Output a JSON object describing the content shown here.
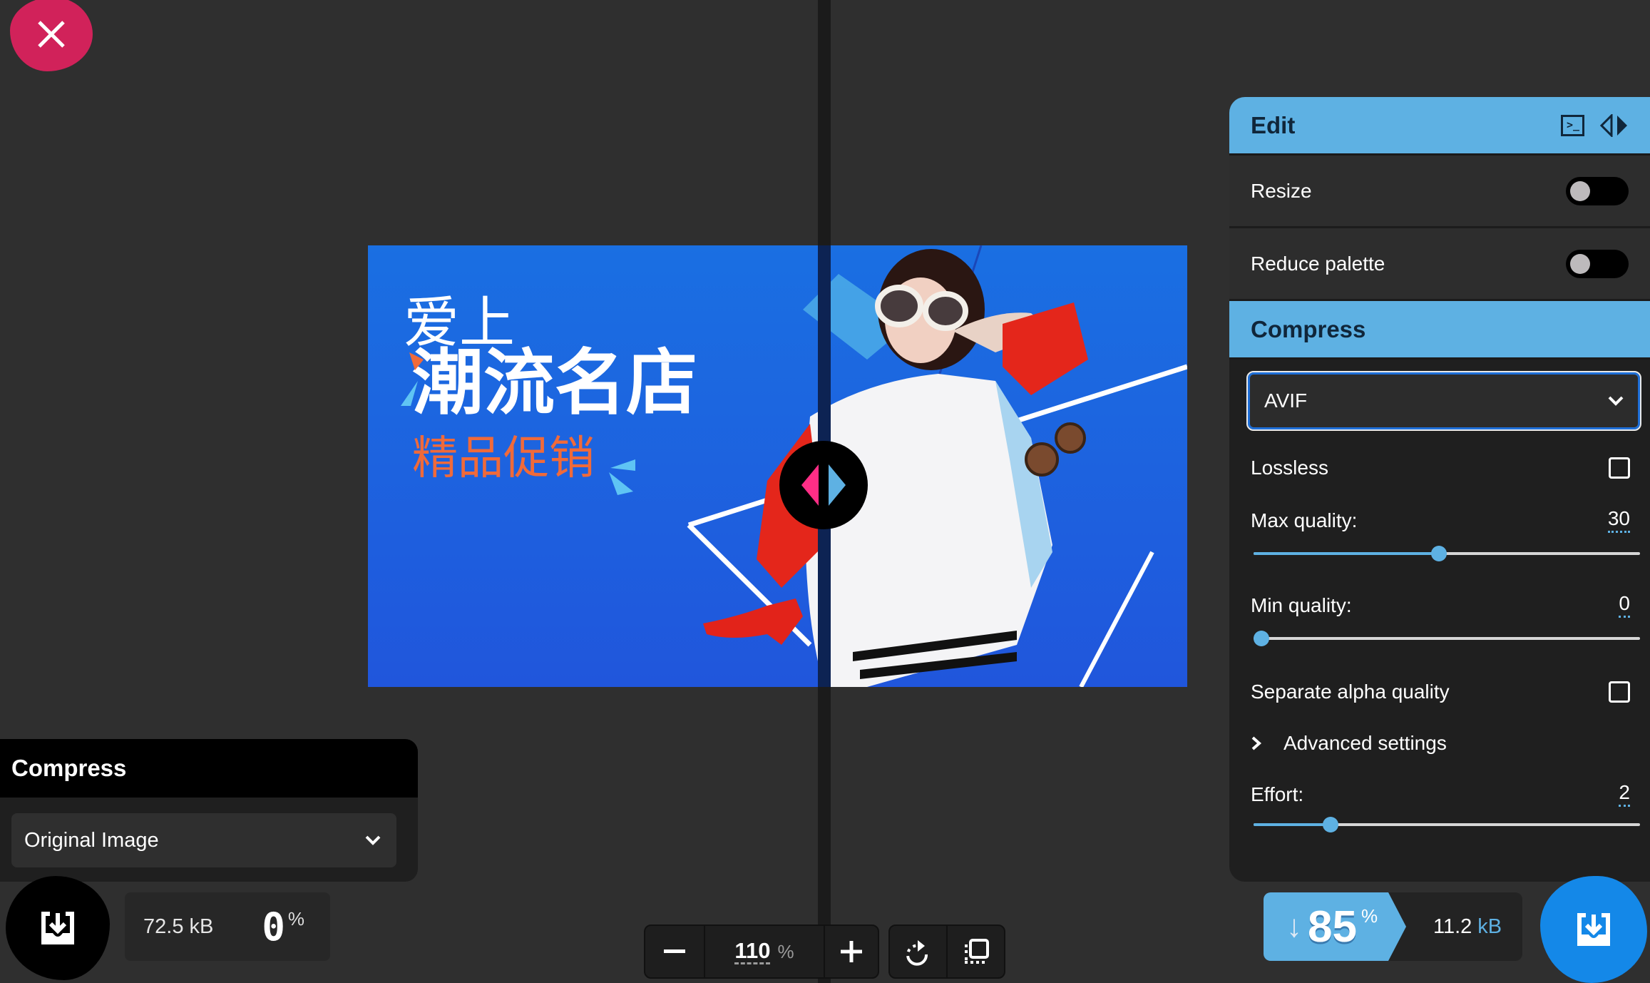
{
  "close": {
    "icon": "close-icon"
  },
  "image": {
    "headline_small": "爱上",
    "headline_large": "潮流名店",
    "subline": "精品促销",
    "colors": {
      "background": "#1f66e0",
      "accent_orange": "#f06a3a",
      "accent_cyan": "#5fc4f4",
      "shirt_red": "#e0261c"
    }
  },
  "compare_handle": {
    "left_color": "#ff2e86",
    "right_color": "#5eb1e3"
  },
  "right_panel": {
    "edit_title": "Edit",
    "edit_icons": [
      "terminal-icon",
      "compare-toggle-icon"
    ],
    "resize_label": "Resize",
    "resize_on": false,
    "reduce_palette_label": "Reduce palette",
    "reduce_palette_on": false,
    "compress_title": "Compress",
    "format_selected": "AVIF",
    "lossless_label": "Lossless",
    "lossless_checked": false,
    "max_quality_label": "Max quality:",
    "max_quality_value": "30",
    "max_quality_fraction": 0.48,
    "min_quality_label": "Min quality:",
    "min_quality_value": "0",
    "min_quality_fraction": 0.0,
    "separate_alpha_label": "Separate alpha quality",
    "separate_alpha_checked": false,
    "advanced_label": "Advanced settings",
    "effort_label": "Effort:",
    "effort_value": "2",
    "effort_fraction": 0.2
  },
  "left_panel": {
    "title": "Compress",
    "format_selected": "Original Image"
  },
  "original_stats": {
    "size": "72.5 kB",
    "percent": "0",
    "percent_sign": "%"
  },
  "zoom": {
    "minus": "−",
    "value": "110",
    "percent_sign": "%",
    "plus": "+"
  },
  "tools": [
    "rotate-icon",
    "background-toggle-icon"
  ],
  "result_stats": {
    "arrow": "↓",
    "percent": "85",
    "percent_sign": "%",
    "size_value": "11.2",
    "size_unit": "kB"
  },
  "colors": {
    "accent": "#5eb1e3",
    "close": "#d1225a",
    "download_blue": "#1488e8",
    "select_border": "#1e6fd8"
  }
}
